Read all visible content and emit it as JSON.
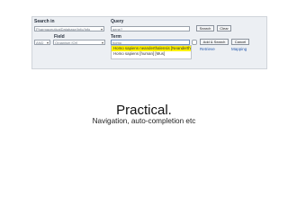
{
  "form": {
    "search_in_label": "Search in",
    "search_in_value": "PharmaceuticalDatabase/Info/Info",
    "query_label": "Query",
    "query_value": "gene?",
    "search_button": "Search",
    "clear_top_button": "Clear",
    "field_label": "Field",
    "term_label": "Term",
    "bool_value": "AND",
    "field_value": "Organism [Or]",
    "term_value": "homo",
    "add_search_button": "Add & Search",
    "cancel_button": "Cancel",
    "suggestions": [
      "Homo sapiens neanderthalensis [Neanderthal]",
      "Homo sapiens [human] [Mus]"
    ],
    "links": [
      "Retrieve",
      "Mapping"
    ]
  },
  "slide": {
    "title": "Practical.",
    "subtitle": "Navigation, auto-completion etc"
  }
}
